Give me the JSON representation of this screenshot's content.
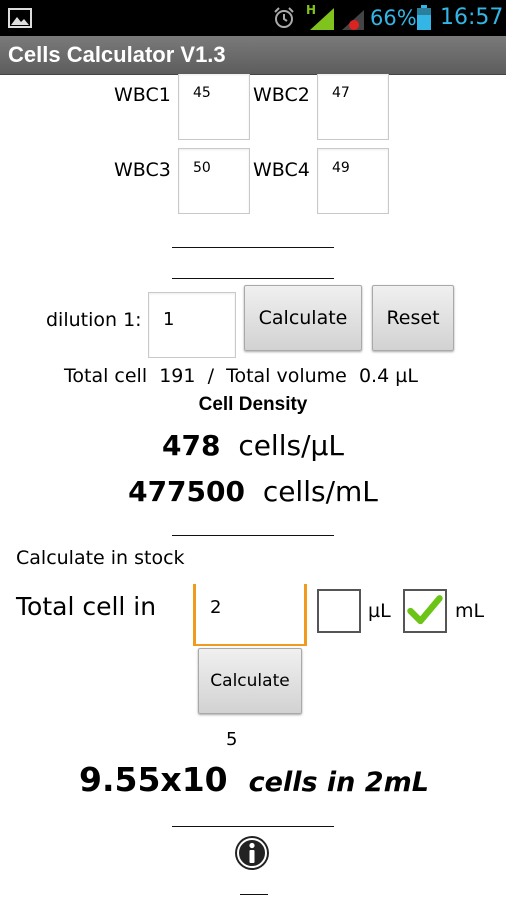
{
  "status_bar": {
    "battery_percent": "66%",
    "time": "16:57",
    "signal_h": "H",
    "accent_color": "#33b5e5",
    "icons": [
      "image-icon",
      "alarm-icon",
      "signal-icon",
      "signal-no-data-icon",
      "battery-icon"
    ]
  },
  "app": {
    "title": "Cells Calculator V1.3"
  },
  "counts": {
    "wbc1": {
      "label": "WBC1",
      "value": "45"
    },
    "wbc2": {
      "label": "WBC2",
      "value": "47"
    },
    "wbc3": {
      "label": "WBC3",
      "value": "50"
    },
    "wbc4": {
      "label": "WBC4",
      "value": "49"
    },
    "separator1": "_______________",
    "separator2": "_______________"
  },
  "dilution": {
    "label": "dilution 1:",
    "value": "1",
    "calculate_label": "Calculate",
    "reset_label": "Reset"
  },
  "summary": {
    "total_cell_label": "Total cell",
    "total_cell_value": "191",
    "slash": "/",
    "total_volume_label": "Total volume",
    "total_volume_value": "0.4 µL"
  },
  "density": {
    "heading": "Cell Density",
    "per_ul_value": "478",
    "per_ul_unit": "cells/µL",
    "per_ml_value": "477500",
    "per_ml_unit": "cells/mL",
    "separator": "_______________"
  },
  "stock": {
    "heading": "Calculate in stock",
    "total_cell_in_label": "Total cell in",
    "volume_value": "2",
    "unit_ul_label": "µL",
    "unit_ul_checked": false,
    "unit_ml_label": "mL",
    "unit_ml_checked": true,
    "calculate_label": "Calculate",
    "result_exponent": "5",
    "result_base": "9.55x10",
    "result_suffix": "cells in 2mL",
    "separator": "_______________",
    "bottom_mark": "___"
  }
}
